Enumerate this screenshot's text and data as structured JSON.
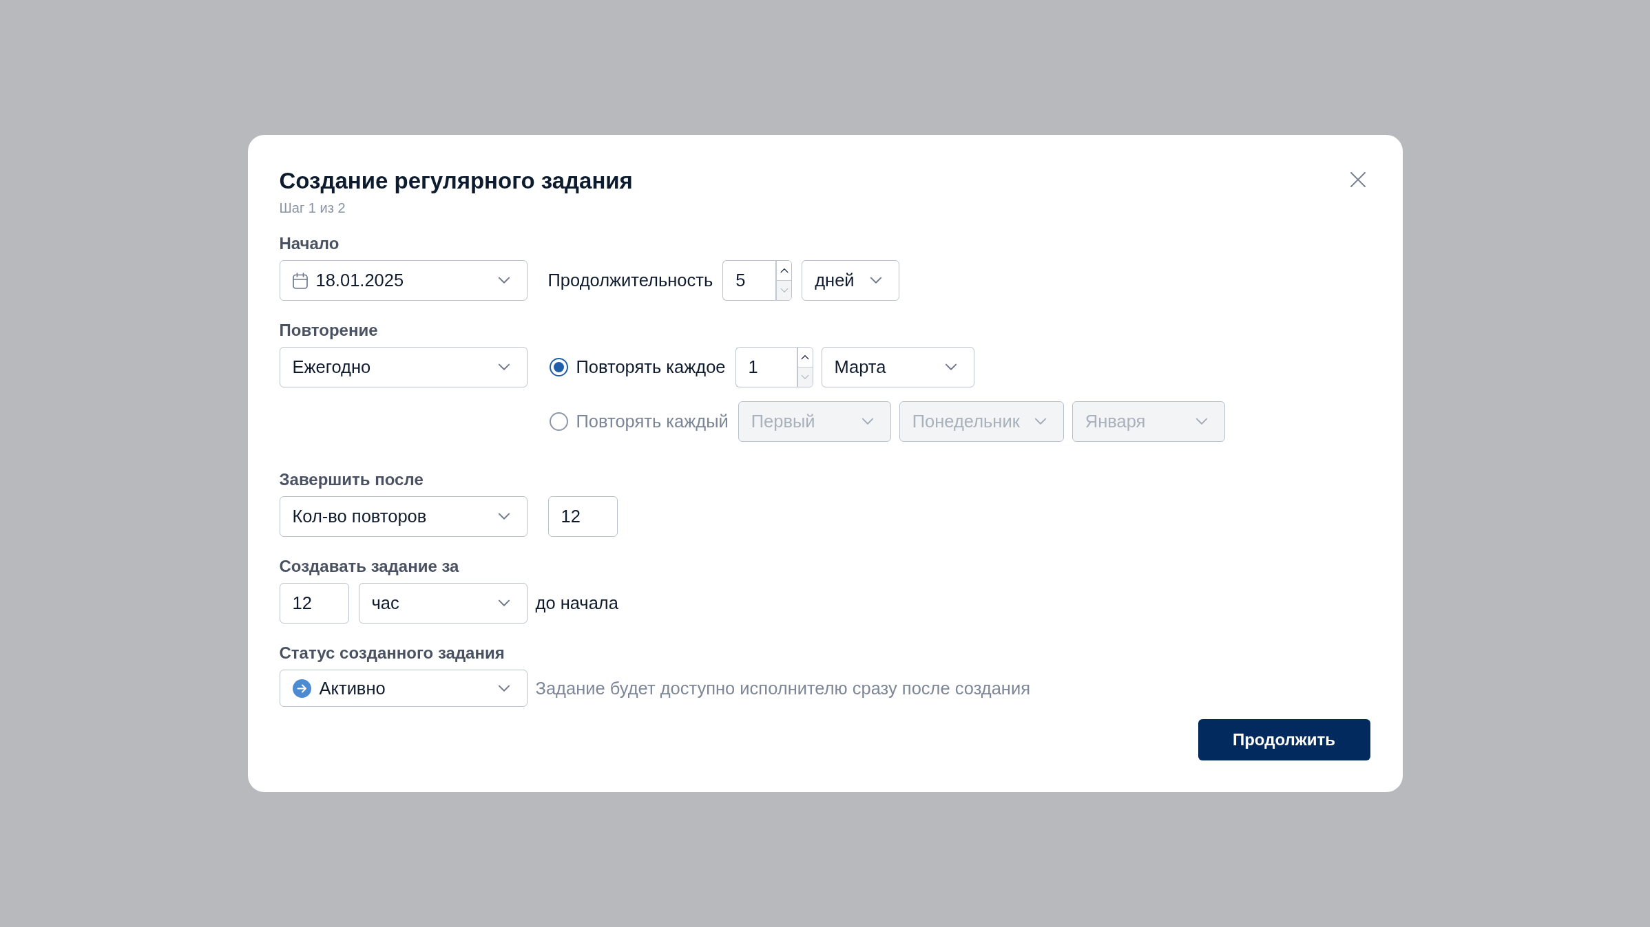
{
  "dialog": {
    "title": "Создание регулярного задания",
    "step": "Шаг 1 из 2"
  },
  "start": {
    "label": "Начало",
    "date": {
      "value": "18.01.2025"
    },
    "duration_label": "Продолжительность",
    "duration": {
      "value": "5",
      "decrement_disabled": true
    },
    "duration_unit": {
      "value": "дней"
    }
  },
  "repeat": {
    "label": "Повторение",
    "frequency": {
      "value": "Ежегодно"
    },
    "options": [
      {
        "label": "Повторять каждое",
        "selected": true,
        "disabled": false,
        "fields": [
          {
            "kind": "number",
            "value": "1",
            "decrement_disabled": true
          },
          {
            "kind": "select",
            "value": "Марта"
          }
        ]
      },
      {
        "label": "Повторять каждый",
        "selected": false,
        "disabled": true,
        "fields": [
          {
            "kind": "select",
            "value": "Первый"
          },
          {
            "kind": "select",
            "value": "Понедельник"
          },
          {
            "kind": "select",
            "value": "Января"
          }
        ]
      }
    ]
  },
  "end_after": {
    "label": "Завершить после",
    "mode": {
      "value": "Кол-во повторов"
    },
    "count": {
      "value": "12"
    }
  },
  "create_before": {
    "label": "Создавать задание за",
    "amount": {
      "value": "12"
    },
    "unit": {
      "value": "час"
    },
    "suffix": "до начала"
  },
  "status": {
    "label": "Статус созданного задания",
    "value": "Активно",
    "hint": "Задание будет доступно исполнителю сразу после создания"
  },
  "footer": {
    "buttons": [
      {
        "label": "Продолжить",
        "kind": "primary"
      }
    ]
  }
}
